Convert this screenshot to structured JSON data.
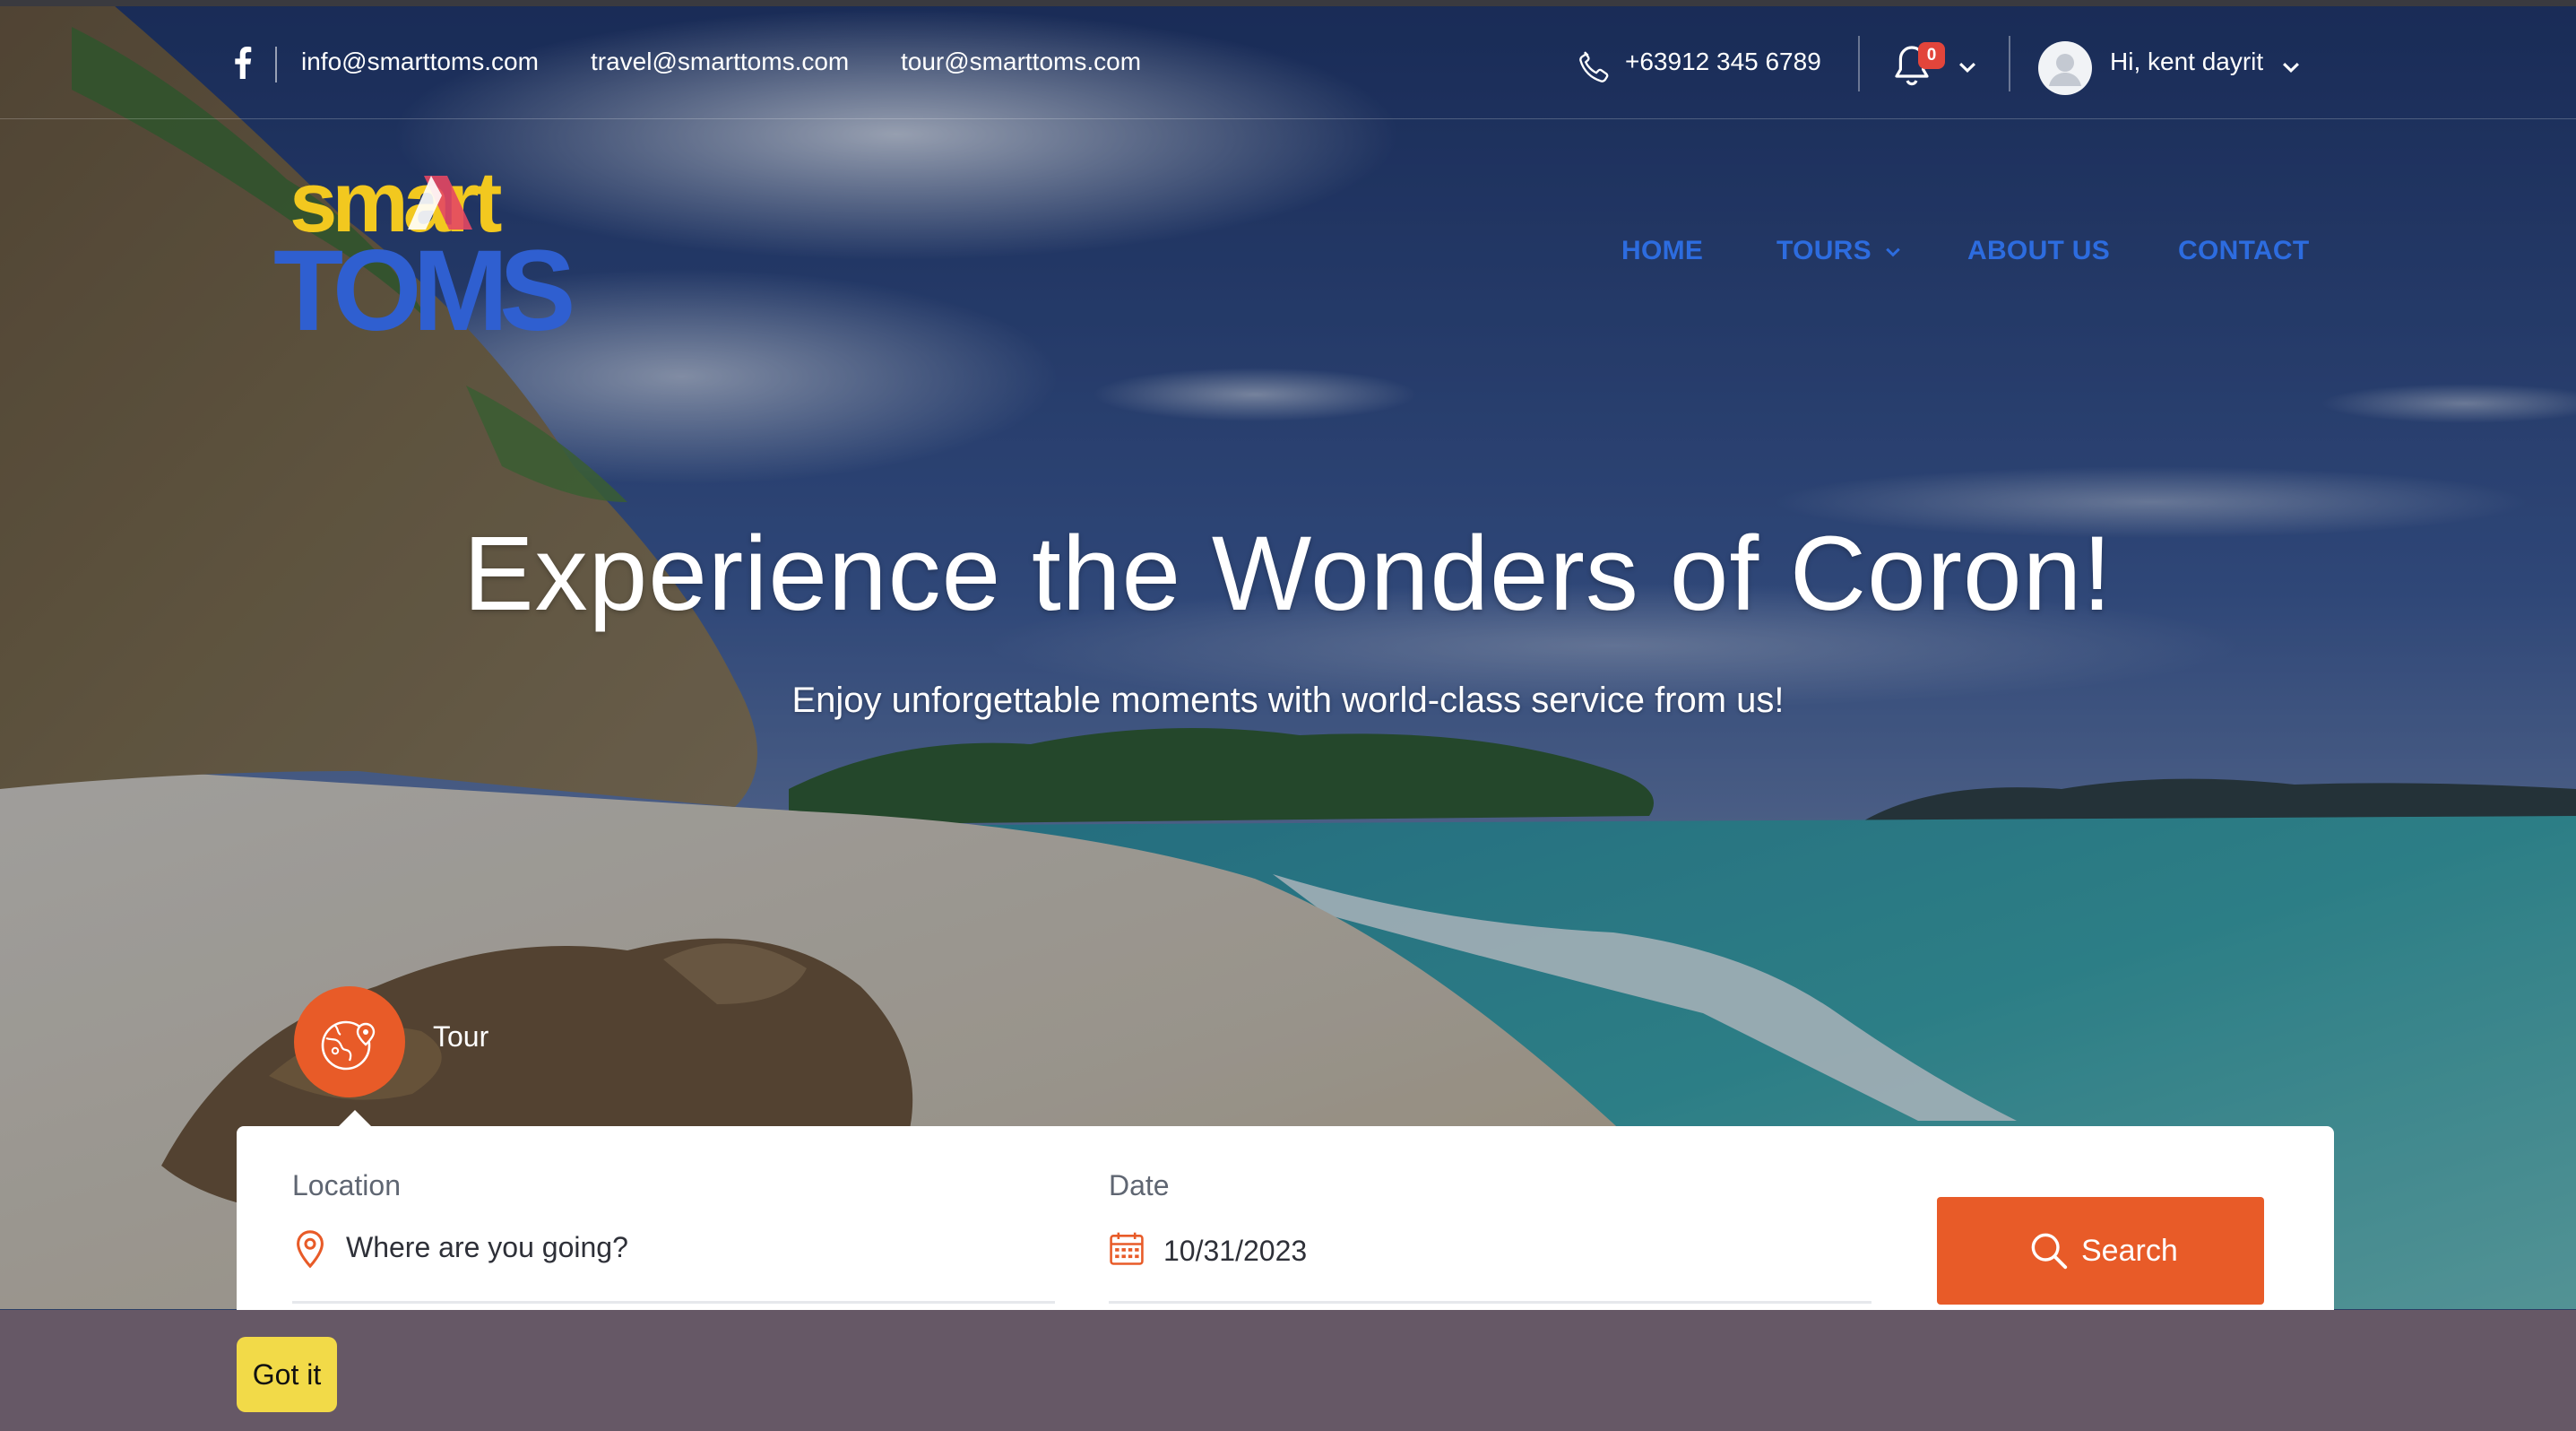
{
  "topbar": {
    "social_icon": "facebook-icon",
    "emails": [
      "info@smarttoms.com",
      "travel@smarttoms.com",
      "tour@smarttoms.com"
    ],
    "phone_icon": "phone-icon",
    "phone": "+63912 345 6789",
    "notifications": {
      "icon": "bell-icon",
      "count": "0"
    },
    "user": {
      "avatar_icon": "user-icon",
      "greeting": "Hi, kent dayrit"
    }
  },
  "logo": {
    "line1": "smart",
    "line2": "TOMS"
  },
  "nav": {
    "items": [
      {
        "label": "HOME"
      },
      {
        "label": "TOURS",
        "dropdown": true
      },
      {
        "label": "ABOUT US"
      },
      {
        "label": "CONTACT"
      }
    ]
  },
  "hero": {
    "title": "Experience the Wonders of Coron!",
    "subtitle": "Enjoy unforgettable moments with world-class service from us!"
  },
  "search": {
    "tab": {
      "label": "Tour",
      "icon": "globe-pin-icon"
    },
    "location": {
      "label": "Location",
      "placeholder": "Where are you going?",
      "icon": "map-pin-icon"
    },
    "date": {
      "label": "Date",
      "value": "10/31/2023",
      "icon": "calendar-icon"
    },
    "button": {
      "label": "Search",
      "icon": "search-icon"
    }
  },
  "cookie": {
    "button": "Got it"
  },
  "colors": {
    "accent": "#e85b28",
    "nav_link": "#2d6cdf",
    "logo_yellow": "#f2c81f",
    "logo_blue": "#2f5fd0",
    "cookie_bar": "#665866",
    "cookie_button": "#f2da48",
    "badge": "#e2453b"
  }
}
